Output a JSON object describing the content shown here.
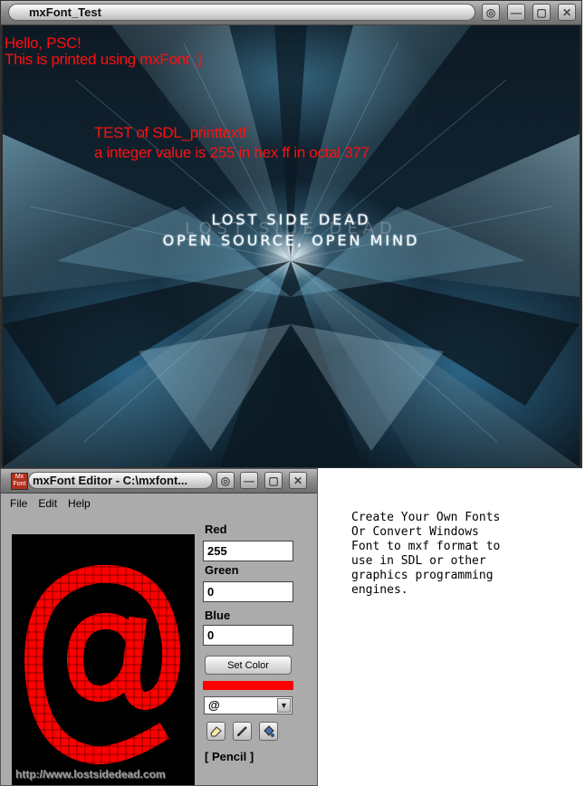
{
  "demo_window": {
    "title": "mxFont_Test",
    "lines": {
      "hello": "Hello, PSC!",
      "printed": "This is printed using mxFont ;]",
      "test": "TEST  of  SDL_printtextf",
      "value": "a  integer value  is  255  in  hex  ff  in  octal 377"
    },
    "logo": {
      "line1": "Lost Side Dead",
      "line2": "Open Source, Open Mind",
      "ghost": "Lost Side Dead"
    }
  },
  "editor_window": {
    "title": "mxFont Editor - C:\\mxfont...",
    "menu": [
      "File",
      "Edit",
      "Help"
    ],
    "fields": {
      "red_label": "Red",
      "red_value": "255",
      "green_label": "Green",
      "green_value": "0",
      "blue_label": "Blue",
      "blue_value": "0"
    },
    "set_color_label": "Set Color",
    "current_color": "#ff0000",
    "selected_char": "@",
    "tools": [
      "eraser-icon",
      "pencil-icon",
      "fill-bucket-icon"
    ],
    "tool_status": "[ Pencil ]",
    "website": "http://www.lostsidedead.com"
  },
  "promo_text": "Create Your Own Fonts\nOr Convert Windows\nFont to mxf format to\nuse in SDL or other\ngraphics programming\nengines."
}
